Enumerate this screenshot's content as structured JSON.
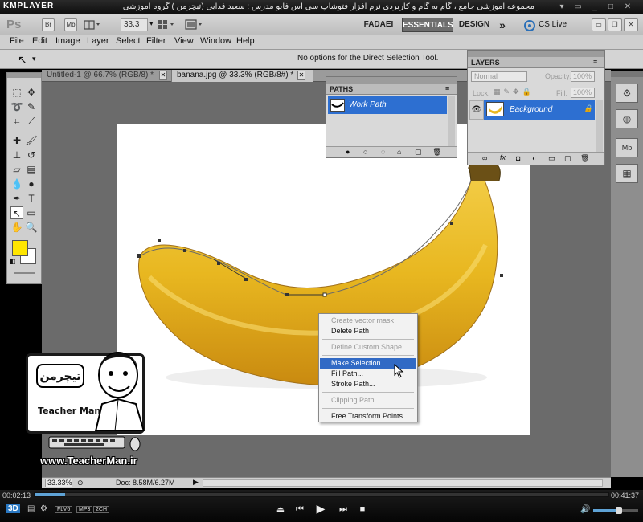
{
  "kmplayer": {
    "logo": "KMPLAYER",
    "title": "مجموعه آموزشی جامع ، گام به گام و کاربردی نرم افزار فتوشاپ سی اس فایو  مدرس : سعید فدایی (تیچرمن ) گروه آموزشی پادشاه گرافیست ها",
    "time_elapsed": "00:02:13",
    "time_total": "00:41:37",
    "progress": 0.053,
    "badges": [
      "FLV6",
      "MP3",
      "2CH"
    ],
    "three_d": "3D"
  },
  "app": {
    "logo": "Ps",
    "bridge": "Br",
    "minibridge": "Mb",
    "zoom": "33.3",
    "workspaces": [
      "FADAEI",
      "ESSENTIALS",
      "DESIGN"
    ],
    "cs_live": "CS Live"
  },
  "menus": [
    "File",
    "Edit",
    "Image",
    "Layer",
    "Select",
    "Filter",
    "View",
    "Window",
    "Help"
  ],
  "options_bar": {
    "message": "No options for the Direct Selection Tool."
  },
  "tabs": [
    {
      "label": "Untitled-1 @ 66.7% (RGB/8) *"
    },
    {
      "label": "banana.jpg @ 33.3% (RGB/8#) *"
    }
  ],
  "paths_panel": {
    "title": "PATHS",
    "item": "Work Path"
  },
  "layers_panel": {
    "title": "LAYERS",
    "blend_mode": "Normal",
    "opacity_label": "Opacity:",
    "opacity_value": "100%",
    "lock_label": "Lock:",
    "fill_label": "Fill:",
    "fill_value": "100%",
    "layer": "Background"
  },
  "context_menu": [
    {
      "label": "Create vector mask",
      "state": "disabled"
    },
    {
      "label": "Delete Path",
      "state": "enabled"
    },
    {
      "label": "Define Custom Shape...",
      "state": "disabled"
    },
    {
      "label": "Make Selection...",
      "state": "selected"
    },
    {
      "label": "Fill Path...",
      "state": "enabled"
    },
    {
      "label": "Stroke Path...",
      "state": "enabled"
    },
    {
      "label": "Clipping Path...",
      "state": "disabled"
    },
    {
      "label": "Free Transform Points",
      "state": "enabled"
    }
  ],
  "status_bar": {
    "zoom": "33.33%",
    "doc": "Doc: 8.58M/6.27M"
  },
  "overlay": {
    "logo_text": "تیچرمن",
    "logo_sub": "Teacher Man",
    "url": "www.TeacherMan.ir"
  },
  "colors": {
    "foreground": "#ffe600",
    "background": "#ffffff",
    "selection": "#2d6fd1",
    "banana": "#e8b720"
  }
}
